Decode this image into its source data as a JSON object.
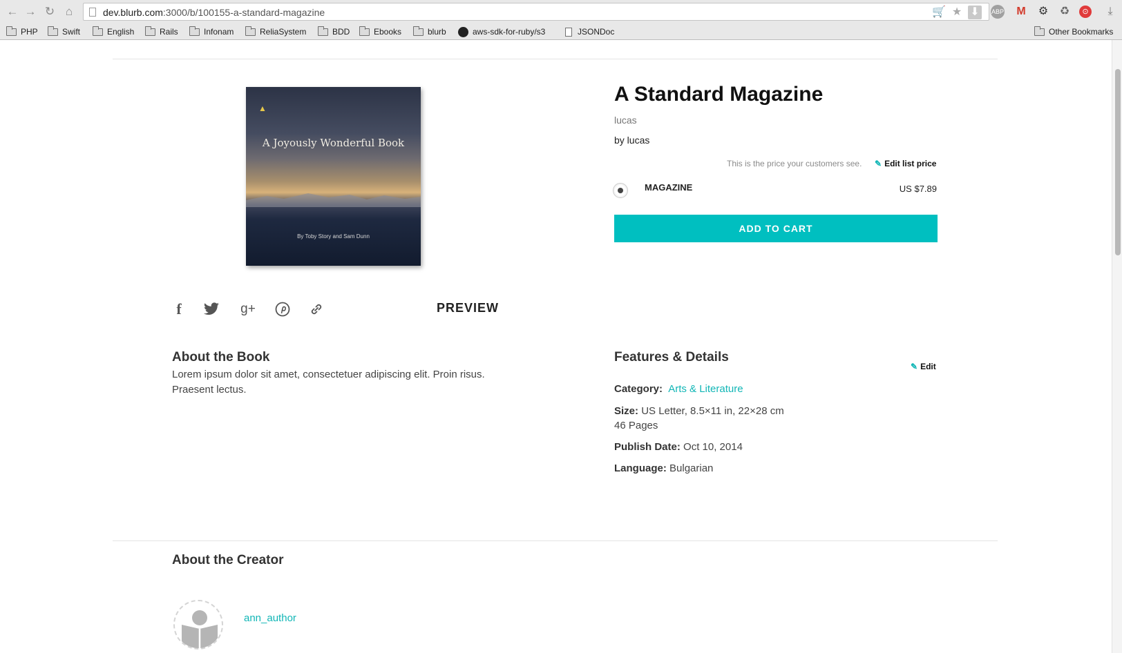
{
  "browser": {
    "url_host": "dev.blurb.com",
    "url_path": ":3000/b/100155-a-standard-magazine",
    "bookmarks": [
      {
        "label": "PHP"
      },
      {
        "label": "Swift"
      },
      {
        "label": "English"
      },
      {
        "label": "Rails"
      },
      {
        "label": "Infonam"
      },
      {
        "label": "ReliaSystem"
      },
      {
        "label": "BDD"
      },
      {
        "label": "Ebooks"
      },
      {
        "label": "blurb"
      },
      {
        "label": "aws-sdk-for-ruby/s3"
      },
      {
        "label": "JSONDoc"
      }
    ],
    "other_bookmarks": "Other Bookmarks"
  },
  "cover": {
    "title": "A Joyously Wonderful Book",
    "author_line": "By Toby Story and Sam Dunn"
  },
  "share": {
    "preview_label": "PREVIEW",
    "icons": [
      "facebook-icon",
      "twitter-icon",
      "google-plus-icon",
      "pinterest-icon",
      "link-icon"
    ]
  },
  "product": {
    "title": "A Standard Magazine",
    "subtitle": "lucas",
    "byline": "by lucas",
    "price_note": "This is the price your customers see.",
    "edit_price_label": "Edit list price",
    "format_label": "MAGAZINE",
    "format_price": "US $7.89",
    "add_to_cart_label": "ADD TO CART"
  },
  "about": {
    "heading": "About the Book",
    "text": "Lorem ipsum dolor sit amet, consectetuer adipiscing elit. Proin risus. Praesent lectus."
  },
  "features": {
    "heading": "Features & Details",
    "edit_label": "Edit",
    "category_label": "Category:",
    "category_value": "Arts & Literature",
    "size_label": "Size:",
    "size_value": "US Letter, 8.5×11 in, 22×28 cm",
    "pages": "46 Pages",
    "publish_label": "Publish Date:",
    "publish_value": "Oct 10, 2014",
    "language_label": "Language:",
    "language_value": "Bulgarian"
  },
  "creator": {
    "heading": "About the Creator",
    "name": "ann_author"
  }
}
